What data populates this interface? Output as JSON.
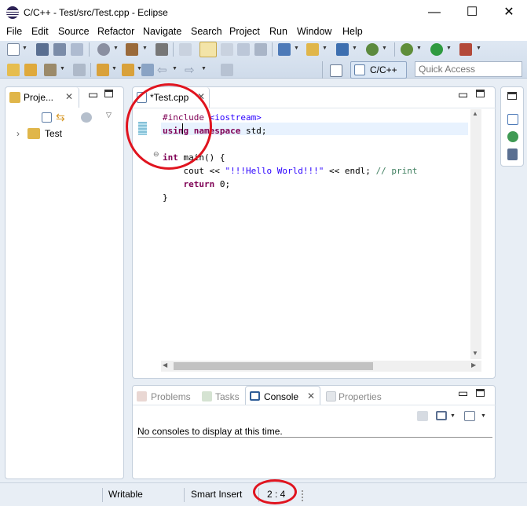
{
  "window": {
    "title": "C/C++ - Test/src/Test.cpp - Eclipse",
    "controls": {
      "minimize": "—",
      "maximize": "☐",
      "close": "✕"
    }
  },
  "menu": [
    "File",
    "Edit",
    "Source",
    "Refactor",
    "Navigate",
    "Search",
    "Project",
    "Run",
    "Window",
    "Help"
  ],
  "toolbar": {
    "perspective_label": "C/C++",
    "quick_access_placeholder": "Quick Access"
  },
  "project_explorer": {
    "tab_label": "Proje...",
    "tree": [
      {
        "label": "Test",
        "expander": "›"
      }
    ]
  },
  "editor": {
    "tab_label": "*Test.cpp",
    "lines": [
      {
        "parts": [
          {
            "cls": "inc",
            "t": "#include "
          },
          {
            "cls": "hdr",
            "t": "<iostream>"
          }
        ]
      },
      {
        "parts": [
          {
            "cls": "kw",
            "t": "using"
          },
          {
            "cls": "",
            "t": " "
          },
          {
            "cls": "kw",
            "t": "namespace"
          },
          {
            "cls": "",
            "t": " std;"
          }
        ],
        "current": true
      },
      {
        "parts": []
      },
      {
        "parts": [
          {
            "cls": "kw",
            "t": "int"
          },
          {
            "cls": "",
            "t": " main() {"
          }
        ],
        "fold": true
      },
      {
        "parts": [
          {
            "cls": "",
            "t": "    cout << "
          },
          {
            "cls": "str",
            "t": "\"!!!Hello World!!!\""
          },
          {
            "cls": "",
            "t": " << endl; "
          },
          {
            "cls": "cm",
            "t": "// print"
          }
        ]
      },
      {
        "parts": [
          {
            "cls": "",
            "t": "    "
          },
          {
            "cls": "kw",
            "t": "return"
          },
          {
            "cls": "",
            "t": " 0;"
          }
        ]
      },
      {
        "parts": [
          {
            "cls": "",
            "t": "}"
          }
        ]
      }
    ]
  },
  "bottom_panel": {
    "tabs": [
      {
        "label": "Problems",
        "active": false
      },
      {
        "label": "Tasks",
        "active": false
      },
      {
        "label": "Console",
        "active": true
      },
      {
        "label": "Properties",
        "active": false
      }
    ],
    "console_message": "No consoles to display at this time."
  },
  "status_bar": {
    "writable": "Writable",
    "insert_mode": "Smart Insert",
    "cursor_position": "2 : 4"
  },
  "colors": {
    "annotation_ring": "#e0141f",
    "keyword": "#7f0055",
    "string": "#2a00ff",
    "comment": "#3f7f5f"
  }
}
